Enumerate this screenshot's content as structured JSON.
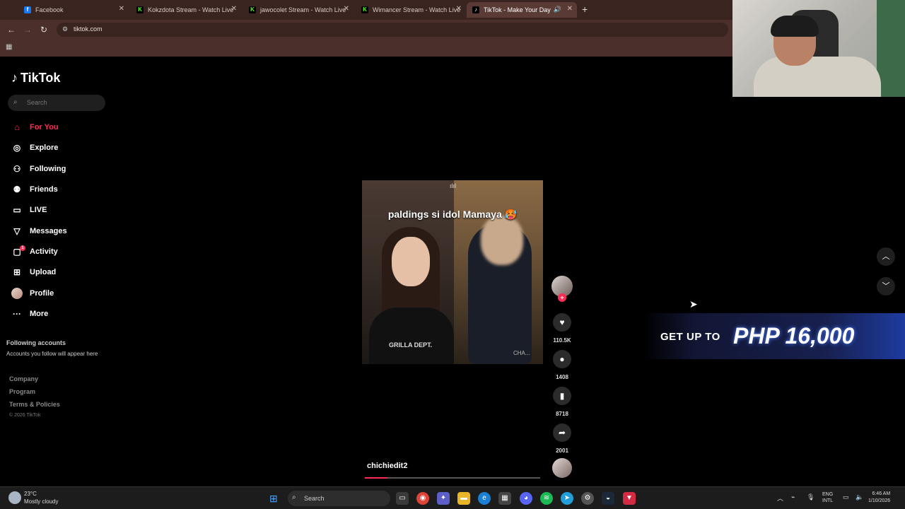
{
  "browser": {
    "tabs": [
      {
        "title": "Facebook",
        "favicon": "facebook-icon",
        "active": false
      },
      {
        "title": "Kokzdota Stream - Watch Live",
        "favicon": "kick-icon",
        "active": false
      },
      {
        "title": "jawocolet Stream - Watch Live",
        "favicon": "kick-icon",
        "active": false
      },
      {
        "title": "Wimancer Stream - Watch Live",
        "favicon": "kick-icon",
        "active": false
      },
      {
        "title": "TikTok - Make Your Day",
        "favicon": "tiktok-icon",
        "active": true
      }
    ],
    "new_tab": "+",
    "url": "tiktok.com"
  },
  "sidebar": {
    "brand": "TikTok",
    "search_placeholder": "Search",
    "nav": [
      {
        "label": "For You",
        "icon": "home-icon",
        "active": true
      },
      {
        "label": "Explore",
        "icon": "compass-icon",
        "active": false
      },
      {
        "label": "Following",
        "icon": "following-icon",
        "active": false
      },
      {
        "label": "Friends",
        "icon": "friends-icon",
        "active": false
      },
      {
        "label": "LIVE",
        "icon": "live-icon",
        "active": false
      },
      {
        "label": "Messages",
        "icon": "messages-icon",
        "active": false
      },
      {
        "label": "Activity",
        "icon": "activity-icon",
        "active": false,
        "badge": "1"
      },
      {
        "label": "Upload",
        "icon": "upload-icon",
        "active": false
      },
      {
        "label": "Profile",
        "icon": "profile-avatar",
        "active": false
      },
      {
        "label": "More",
        "icon": "more-icon",
        "active": false
      }
    ],
    "following_accounts_title": "Following accounts",
    "following_accounts_sub": "Accounts you follow will appear here",
    "footer_links": [
      "Company",
      "Program",
      "Terms & Policies"
    ],
    "copyright": "© 2026 TikTok"
  },
  "video": {
    "caption": "paldings si idol Mamaya 🥵",
    "shirt_text": "GRILLA DEPT.",
    "watermark": "CHA...",
    "username": "chichiedit2",
    "progress_percent": 13
  },
  "actions": {
    "likes": "110.5K",
    "comments": "1408",
    "saves": "8718",
    "shares": "2001"
  },
  "ad": {
    "prefix": "GET UP TO",
    "amount": "PHP 16,000"
  },
  "taskbar": {
    "weather_temp": "23°C",
    "weather_desc": "Mostly cloudy",
    "search_label": "Search",
    "lang_top": "ENG",
    "lang_bottom": "INTL",
    "time": "6:46 AM",
    "date": "1/10/2026"
  },
  "colors": {
    "accent": "#fe2c55",
    "chrome_bg": "#3a2420",
    "page_bg": "#000000"
  }
}
